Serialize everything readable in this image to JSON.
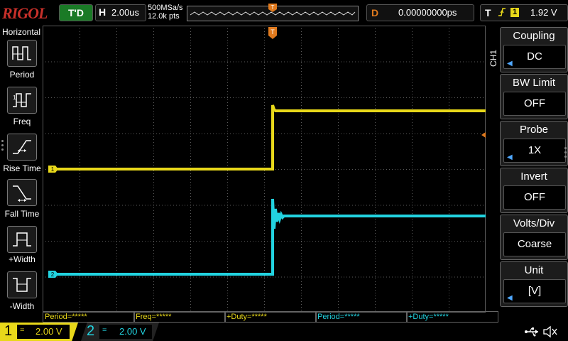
{
  "brand": "RIGOL",
  "run_status": "T'D",
  "timebase": {
    "label": "H",
    "value": "2.00us"
  },
  "acquisition": {
    "sample_rate": "500MSa/s",
    "memory_depth": "12.0k pts"
  },
  "trigger_position_marker": "T",
  "delay": {
    "label": "D",
    "value": "0.00000000ps"
  },
  "trigger": {
    "label": "T",
    "edge_icon": "rising-edge-icon",
    "source": "1",
    "level": "1.92 V"
  },
  "left_menu": {
    "title": "Horizontal",
    "items": [
      {
        "label": "Period",
        "icon": "period-icon"
      },
      {
        "label": "Freq",
        "icon": "freq-icon"
      },
      {
        "label": "Rise Time",
        "icon": "rise-time-icon"
      },
      {
        "label": "Fall Time",
        "icon": "fall-time-icon"
      },
      {
        "label": "+Width",
        "icon": "positive-width-icon"
      },
      {
        "label": "-Width",
        "icon": "negative-width-icon"
      }
    ]
  },
  "right_menu": {
    "channel_tag": "CH1",
    "items": [
      {
        "title": "Coupling",
        "value": "DC"
      },
      {
        "title": "BW Limit",
        "value": "OFF"
      },
      {
        "title": "Probe",
        "value": "1X"
      },
      {
        "title": "Invert",
        "value": "OFF"
      },
      {
        "title": "Volts/Div",
        "value": "Coarse"
      },
      {
        "title": "Unit",
        "value": "[V]"
      }
    ]
  },
  "measurements": [
    {
      "text": "Period=*****",
      "color": "#e8d81a"
    },
    {
      "text": "Freq=*****",
      "color": "#e8d81a"
    },
    {
      "text": "+Duty=*****",
      "color": "#e8d81a"
    },
    {
      "text": "Period=*****",
      "color": "#22d3e0"
    },
    {
      "text": "+Duty=*****",
      "color": "#22d3e0"
    }
  ],
  "channels": [
    {
      "number": "1",
      "coupling": "=",
      "scale": "2.00 V",
      "color": "#e8d81a",
      "marker": "1"
    },
    {
      "number": "2",
      "coupling": "=",
      "scale": "2.00 V",
      "color": "#22d3e0",
      "marker": "2"
    }
  ],
  "colors": {
    "ch1": "#e8d81a",
    "ch2": "#22d3e0",
    "trigger": "#e07a1e",
    "grid": "#5a5a5a"
  }
}
